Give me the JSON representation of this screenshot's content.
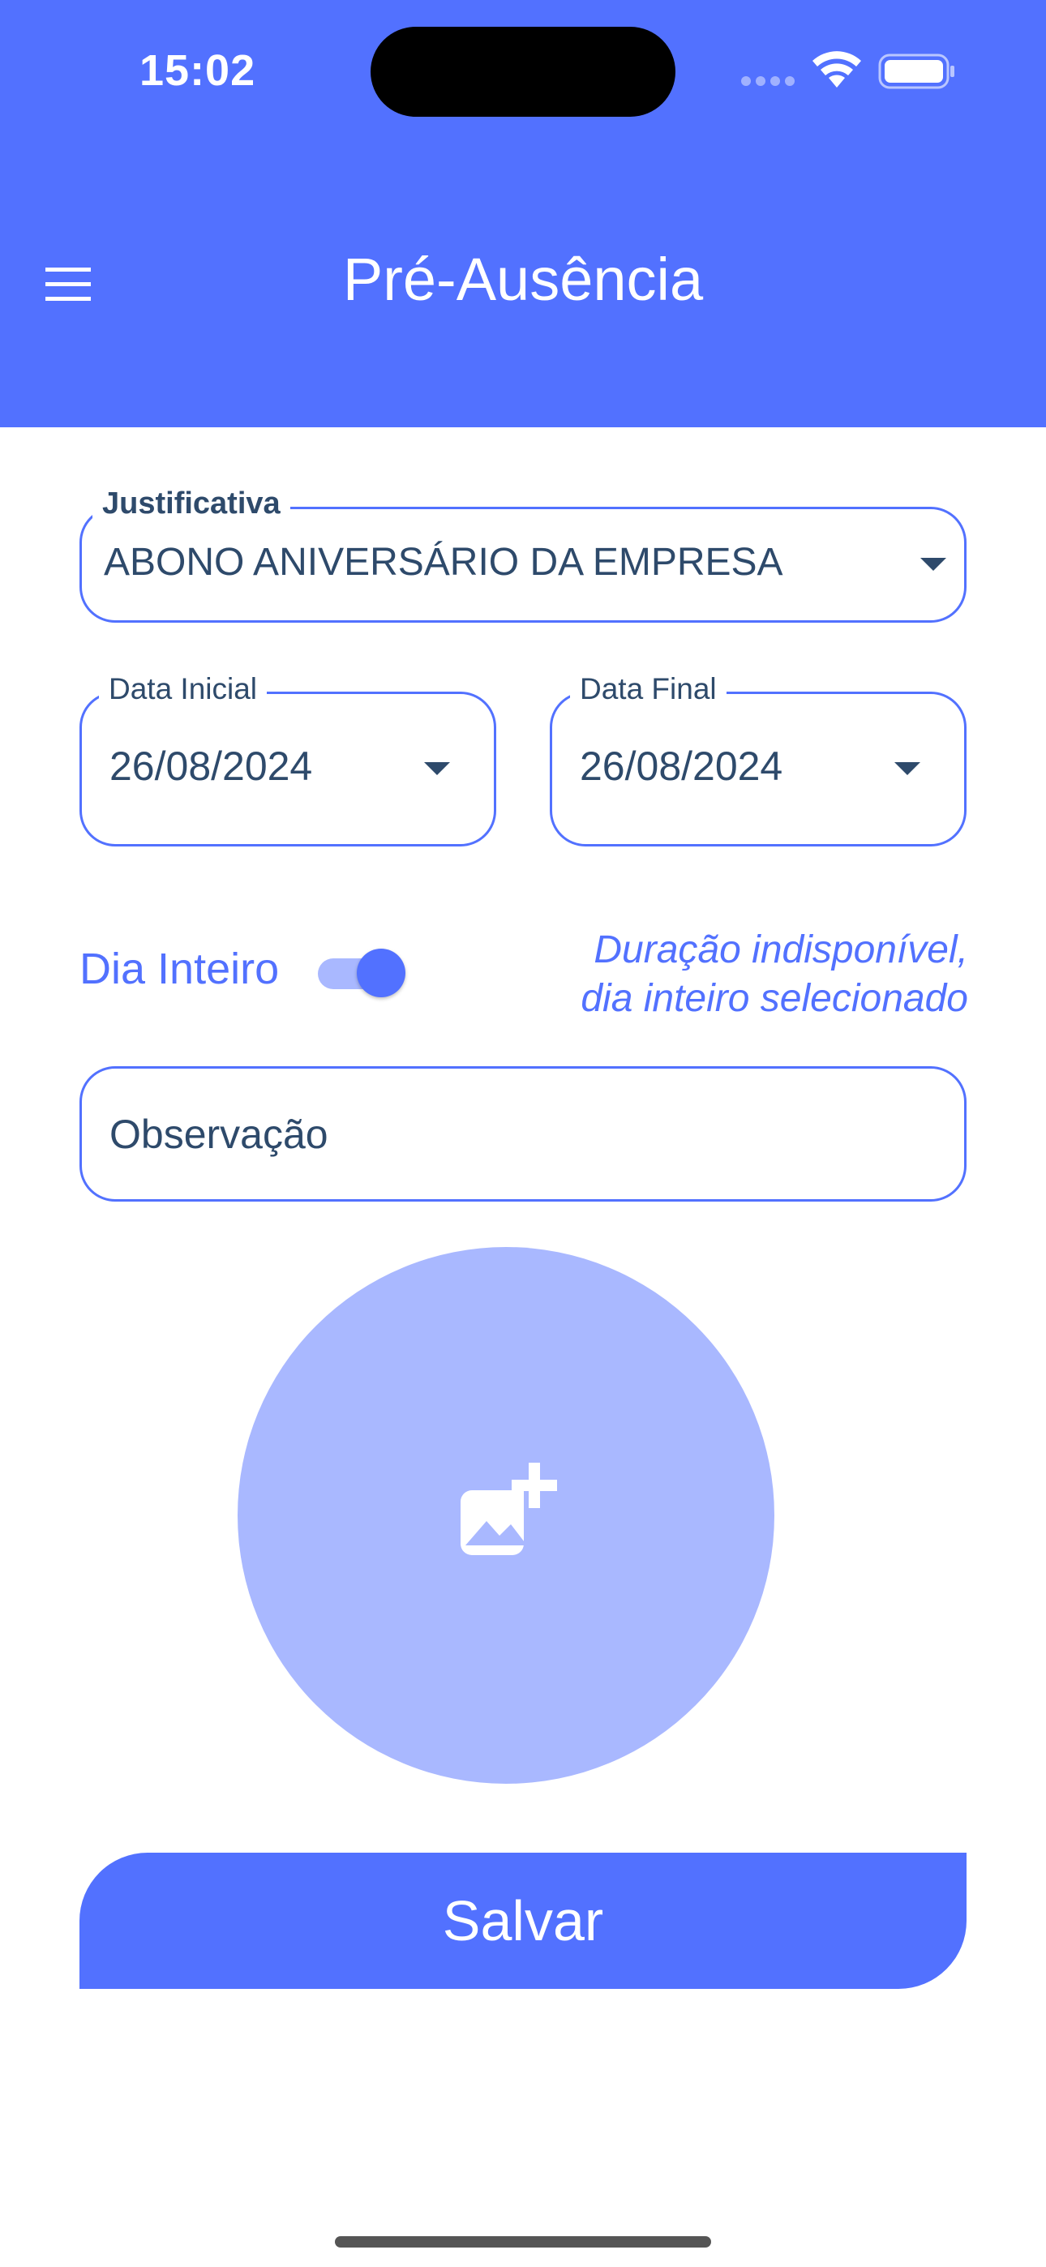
{
  "status_bar": {
    "time": "15:02"
  },
  "header": {
    "title": "Pré-Ausência",
    "menu_icon": "hamburger-menu-icon"
  },
  "form": {
    "justificativa": {
      "label": "Justificativa",
      "value": "ABONO ANIVERSÁRIO DA EMPRESA"
    },
    "data_inicial": {
      "label": "Data Inicial",
      "value": "26/08/2024"
    },
    "data_final": {
      "label": "Data Final",
      "value": "26/08/2024"
    },
    "dia_inteiro": {
      "label": "Dia Inteiro",
      "enabled": true
    },
    "duration_note": {
      "line1": "Duração indisponível,",
      "line2": "dia inteiro selecionado"
    },
    "observacao": {
      "placeholder": "Observação"
    },
    "photo": {
      "icon": "add-photo-icon"
    },
    "save_label": "Salvar"
  },
  "colors": {
    "primary": "#5271FF",
    "primary_light": "#A9B8FF",
    "text": "#2E4A6B"
  }
}
